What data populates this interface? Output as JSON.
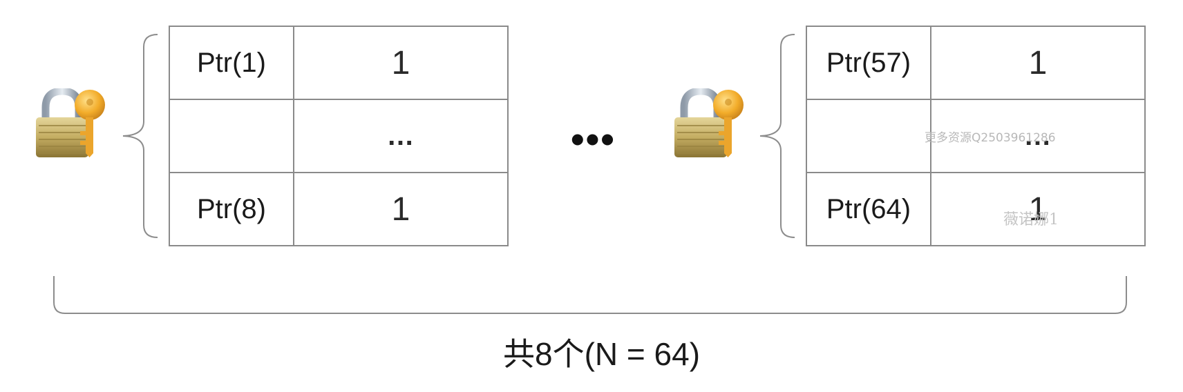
{
  "shards": [
    {
      "rows": [
        {
          "ptr": "Ptr(1)",
          "value": "1"
        },
        {
          "ptr": "",
          "value": "…"
        },
        {
          "ptr": "Ptr(8)",
          "value": "1"
        }
      ],
      "lock_icon": "lock-with-key-icon"
    },
    {
      "rows": [
        {
          "ptr": "Ptr(57)",
          "value": "1"
        },
        {
          "ptr": "",
          "value": "…"
        },
        {
          "ptr": "Ptr(64)",
          "value": "1"
        }
      ],
      "lock_icon": "lock-with-key-icon"
    }
  ],
  "between_ellipsis": "•••",
  "caption": "共8个(N = 64)",
  "watermarks": {
    "contact": "更多资源Q2503961286",
    "author": "薇诺娜1"
  },
  "colors": {
    "border": "#8a8a8a",
    "brace": "#8c8c8c",
    "lock_body": "#c9b46a",
    "key": "#f0b030"
  }
}
